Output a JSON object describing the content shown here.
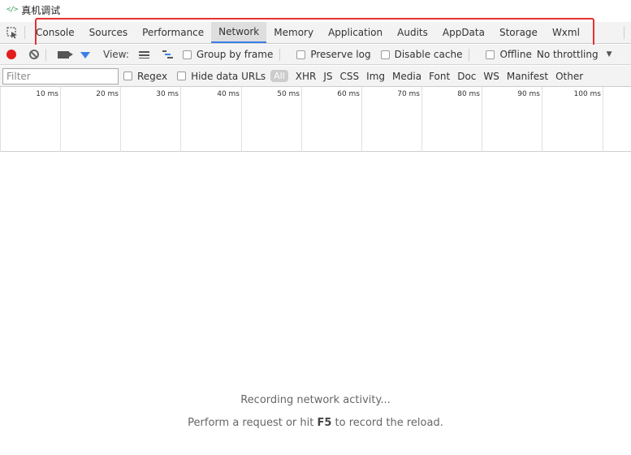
{
  "window": {
    "title": "真机调试",
    "title_icon": "code-brackets-icon"
  },
  "tabs": {
    "items": [
      "Console",
      "Sources",
      "Performance",
      "Network",
      "Memory",
      "Application",
      "Audits",
      "AppData",
      "Storage",
      "Wxml"
    ],
    "active": "Network",
    "highlight_color": "#e53131"
  },
  "toolbar": {
    "view_label": "View:",
    "group_by_frame": "Group by frame",
    "preserve_log": "Preserve log",
    "disable_cache": "Disable cache",
    "offline": "Offline",
    "throttling": "No throttling"
  },
  "filter": {
    "placeholder": "Filter",
    "regex": "Regex",
    "hide_data_urls": "Hide data URLs",
    "types": [
      "All",
      "XHR",
      "JS",
      "CSS",
      "Img",
      "Media",
      "Font",
      "Doc",
      "WS",
      "Manifest",
      "Other"
    ]
  },
  "timeline": {
    "ticks": [
      "10 ms",
      "20 ms",
      "30 ms",
      "40 ms",
      "50 ms",
      "60 ms",
      "70 ms",
      "80 ms",
      "90 ms",
      "100 ms"
    ]
  },
  "empty_state": {
    "recording": "Recording network activity...",
    "hint_prefix": "Perform a request or hit ",
    "hint_key": "F5",
    "hint_suffix": " to record the reload."
  },
  "colors": {
    "record": "#e21d1d",
    "accent": "#3b80e8"
  }
}
